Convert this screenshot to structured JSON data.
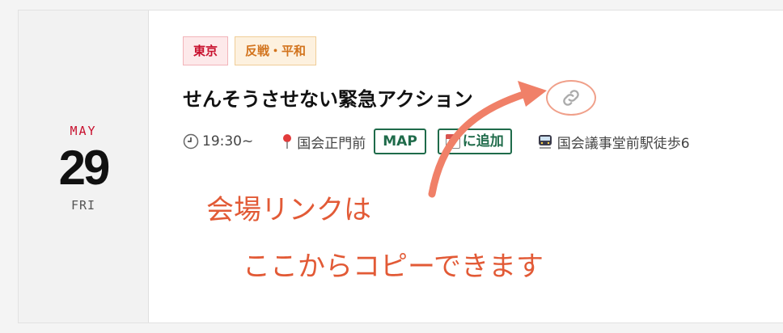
{
  "event": {
    "month": "MAY",
    "day": "29",
    "weekday": "FRI",
    "tags": [
      "東京",
      "反戦・平和"
    ],
    "title": "せんそうさせない緊急アクション",
    "time": "19:30~",
    "venue": "国会正門前",
    "map_label": "MAP",
    "calendar_label": "に追加",
    "calendar_icon_day": "17",
    "access": "国会議事堂前駅徒歩6"
  },
  "annotation": {
    "line1": "会場リンクは",
    "line2": "ここからコピーできます"
  },
  "icons": {
    "clock": "clock-icon",
    "pin": "map-pin-icon",
    "train": "train-icon",
    "link": "link-icon",
    "calendar": "calendar-icon"
  },
  "colors": {
    "accent_red": "#c8102e",
    "tag_orange": "#d2731c",
    "button_green": "#1f6b4a",
    "annotation": "#e25a36"
  }
}
